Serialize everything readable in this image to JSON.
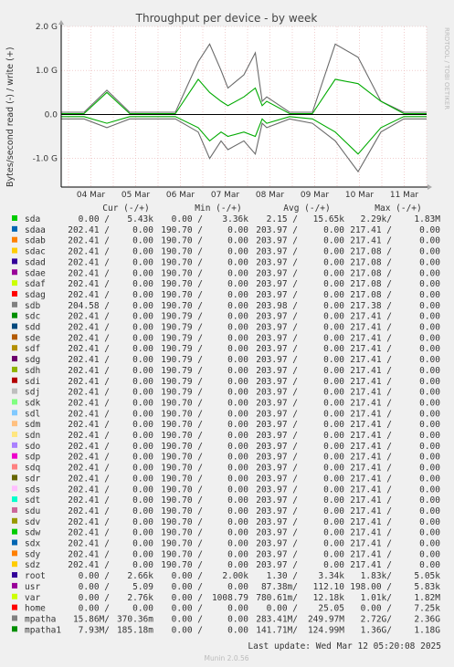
{
  "chart_data": {
    "type": "line",
    "title": "Throughput per device - by week",
    "ylabel": "Bytes/second read (-) / write (+)",
    "side_label": "RRDTOOL / TOBI OETIKER",
    "ylim": [
      -1.65,
      2.0
    ],
    "y_ticks": [
      {
        "value": 2.0,
        "label": "2.0 G"
      },
      {
        "value": 1.0,
        "label": "1.0 G"
      },
      {
        "value": 0.0,
        "label": "0.0"
      },
      {
        "value": -1.0,
        "label": "-1.0 G"
      }
    ],
    "x_ticks": [
      "04 Mar",
      "05 Mar",
      "06 Mar",
      "07 Mar",
      "08 Mar",
      "09 Mar",
      "10 Mar",
      "11 Mar"
    ],
    "columns": [
      "Cur (-/+)",
      "Min (-/+)",
      "Avg (-/+)",
      "Max (-/+)"
    ],
    "series": [
      {
        "name": "mpatha",
        "color": "#6a6a6a",
        "write": [
          [
            0,
            0.05
          ],
          [
            1,
            0.05
          ],
          [
            2,
            0.55
          ],
          [
            3,
            0.05
          ],
          [
            4,
            0.05
          ],
          [
            5,
            0.05
          ],
          [
            6,
            1.2
          ],
          [
            6.5,
            1.6
          ],
          [
            7,
            1.0
          ],
          [
            7.3,
            0.6
          ],
          [
            8,
            0.9
          ],
          [
            8.5,
            1.4
          ],
          [
            8.8,
            0.3
          ],
          [
            9,
            0.4
          ],
          [
            10,
            0.05
          ],
          [
            11,
            0.05
          ],
          [
            12,
            1.6
          ],
          [
            13,
            1.3
          ],
          [
            14,
            0.3
          ],
          [
            15,
            0.05
          ],
          [
            16,
            0.05
          ]
        ],
        "read": [
          [
            0,
            -0.1
          ],
          [
            1,
            -0.1
          ],
          [
            2,
            -0.3
          ],
          [
            3,
            -0.1
          ],
          [
            4,
            -0.1
          ],
          [
            5,
            -0.1
          ],
          [
            6,
            -0.4
          ],
          [
            6.5,
            -1.0
          ],
          [
            7,
            -0.6
          ],
          [
            7.3,
            -0.8
          ],
          [
            8,
            -0.6
          ],
          [
            8.5,
            -0.9
          ],
          [
            8.8,
            -0.2
          ],
          [
            9,
            -0.3
          ],
          [
            10,
            -0.1
          ],
          [
            11,
            -0.2
          ],
          [
            12,
            -0.6
          ],
          [
            13,
            -1.3
          ],
          [
            14,
            -0.4
          ],
          [
            15,
            -0.1
          ],
          [
            16,
            -0.1
          ]
        ]
      },
      {
        "name": "mpatha1",
        "color": "#00aa00",
        "write": [
          [
            0,
            0.02
          ],
          [
            1,
            0.02
          ],
          [
            2,
            0.5
          ],
          [
            3,
            0.02
          ],
          [
            4,
            0.02
          ],
          [
            5,
            0.02
          ],
          [
            6,
            0.8
          ],
          [
            6.5,
            0.5
          ],
          [
            7,
            0.3
          ],
          [
            7.3,
            0.2
          ],
          [
            8,
            0.4
          ],
          [
            8.5,
            0.6
          ],
          [
            8.8,
            0.2
          ],
          [
            9,
            0.3
          ],
          [
            10,
            0.02
          ],
          [
            11,
            0.02
          ],
          [
            12,
            0.8
          ],
          [
            13,
            0.7
          ],
          [
            14,
            0.3
          ],
          [
            15,
            0.02
          ],
          [
            16,
            0.02
          ]
        ],
        "read": [
          [
            0,
            -0.05
          ],
          [
            1,
            -0.05
          ],
          [
            2,
            -0.2
          ],
          [
            3,
            -0.05
          ],
          [
            4,
            -0.05
          ],
          [
            5,
            -0.05
          ],
          [
            6,
            -0.3
          ],
          [
            6.5,
            -0.6
          ],
          [
            7,
            -0.4
          ],
          [
            7.3,
            -0.5
          ],
          [
            8,
            -0.4
          ],
          [
            8.5,
            -0.5
          ],
          [
            8.8,
            -0.1
          ],
          [
            9,
            -0.2
          ],
          [
            10,
            -0.05
          ],
          [
            11,
            -0.1
          ],
          [
            12,
            -0.4
          ],
          [
            13,
            -0.9
          ],
          [
            14,
            -0.3
          ],
          [
            15,
            -0.05
          ],
          [
            16,
            -0.05
          ]
        ]
      }
    ],
    "legend_rows": [
      [
        "sda",
        "#00cc00",
        "0.00 /",
        "5.43k",
        "0.00 /",
        "3.36k",
        "2.15 /",
        "15.65k",
        "2.29k/",
        "1.83M"
      ],
      [
        "sdaa",
        "#0066b3",
        "202.41 /",
        "0.00",
        "190.70 /",
        "0.00",
        "203.97 /",
        "0.00",
        "217.41 /",
        "0.00"
      ],
      [
        "sdab",
        "#ff8000",
        "202.41 /",
        "0.00",
        "190.70 /",
        "0.00",
        "203.97 /",
        "0.00",
        "217.41 /",
        "0.00"
      ],
      [
        "sdac",
        "#ffcc00",
        "202.41 /",
        "0.00",
        "190.70 /",
        "0.00",
        "203.97 /",
        "0.00",
        "217.08 /",
        "0.00"
      ],
      [
        "sdad",
        "#330099",
        "202.41 /",
        "0.00",
        "190.70 /",
        "0.00",
        "203.97 /",
        "0.00",
        "217.08 /",
        "0.00"
      ],
      [
        "sdae",
        "#990099",
        "202.41 /",
        "0.00",
        "190.70 /",
        "0.00",
        "203.97 /",
        "0.00",
        "217.08 /",
        "0.00"
      ],
      [
        "sdaf",
        "#ccff00",
        "202.41 /",
        "0.00",
        "190.70 /",
        "0.00",
        "203.97 /",
        "0.00",
        "217.08 /",
        "0.00"
      ],
      [
        "sdag",
        "#ff0000",
        "202.41 /",
        "0.00",
        "190.70 /",
        "0.00",
        "203.97 /",
        "0.00",
        "217.08 /",
        "0.00"
      ],
      [
        "sdb",
        "#808080",
        "204.58 /",
        "0.00",
        "190.70 /",
        "0.00",
        "203.98 /",
        "0.00",
        "217.38 /",
        "0.00"
      ],
      [
        "sdc",
        "#008f00",
        "202.41 /",
        "0.00",
        "190.79 /",
        "0.00",
        "203.97 /",
        "0.00",
        "217.41 /",
        "0.00"
      ],
      [
        "sdd",
        "#00487d",
        "202.41 /",
        "0.00",
        "190.79 /",
        "0.00",
        "203.97 /",
        "0.00",
        "217.41 /",
        "0.00"
      ],
      [
        "sde",
        "#b35a00",
        "202.41 /",
        "0.00",
        "190.79 /",
        "0.00",
        "203.97 /",
        "0.00",
        "217.41 /",
        "0.00"
      ],
      [
        "sdf",
        "#b38f00",
        "202.41 /",
        "0.00",
        "190.79 /",
        "0.00",
        "203.97 /",
        "0.00",
        "217.41 /",
        "0.00"
      ],
      [
        "sdg",
        "#6b006b",
        "202.41 /",
        "0.00",
        "190.79 /",
        "0.00",
        "203.97 /",
        "0.00",
        "217.41 /",
        "0.00"
      ],
      [
        "sdh",
        "#8fb300",
        "202.41 /",
        "0.00",
        "190.79 /",
        "0.00",
        "203.97 /",
        "0.00",
        "217.41 /",
        "0.00"
      ],
      [
        "sdi",
        "#b30000",
        "202.41 /",
        "0.00",
        "190.79 /",
        "0.00",
        "203.97 /",
        "0.00",
        "217.41 /",
        "0.00"
      ],
      [
        "sdj",
        "#bebebe",
        "202.41 /",
        "0.00",
        "190.79 /",
        "0.00",
        "203.97 /",
        "0.00",
        "217.41 /",
        "0.00"
      ],
      [
        "sdk",
        "#80ff80",
        "202.41 /",
        "0.00",
        "190.70 /",
        "0.00",
        "203.97 /",
        "0.00",
        "217.41 /",
        "0.00"
      ],
      [
        "sdl",
        "#80c9ff",
        "202.41 /",
        "0.00",
        "190.70 /",
        "0.00",
        "203.97 /",
        "0.00",
        "217.41 /",
        "0.00"
      ],
      [
        "sdm",
        "#ffc080",
        "202.41 /",
        "0.00",
        "190.70 /",
        "0.00",
        "203.97 /",
        "0.00",
        "217.41 /",
        "0.00"
      ],
      [
        "sdn",
        "#ffe680",
        "202.41 /",
        "0.00",
        "190.70 /",
        "0.00",
        "203.97 /",
        "0.00",
        "217.41 /",
        "0.00"
      ],
      [
        "sdo",
        "#aa80ff",
        "202.41 /",
        "0.00",
        "190.70 /",
        "0.00",
        "203.97 /",
        "0.00",
        "217.41 /",
        "0.00"
      ],
      [
        "sdp",
        "#ee00cc",
        "202.41 /",
        "0.00",
        "190.70 /",
        "0.00",
        "203.97 /",
        "0.00",
        "217.41 /",
        "0.00"
      ],
      [
        "sdq",
        "#ff8080",
        "202.41 /",
        "0.00",
        "190.70 /",
        "0.00",
        "203.97 /",
        "0.00",
        "217.41 /",
        "0.00"
      ],
      [
        "sdr",
        "#666600",
        "202.41 /",
        "0.00",
        "190.70 /",
        "0.00",
        "203.97 /",
        "0.00",
        "217.41 /",
        "0.00"
      ],
      [
        "sds",
        "#ffbfff",
        "202.41 /",
        "0.00",
        "190.70 /",
        "0.00",
        "203.97 /",
        "0.00",
        "217.41 /",
        "0.00"
      ],
      [
        "sdt",
        "#00ffcc",
        "202.41 /",
        "0.00",
        "190.70 /",
        "0.00",
        "203.97 /",
        "0.00",
        "217.41 /",
        "0.00"
      ],
      [
        "sdu",
        "#cc6699",
        "202.41 /",
        "0.00",
        "190.70 /",
        "0.00",
        "203.97 /",
        "0.00",
        "217.41 /",
        "0.00"
      ],
      [
        "sdv",
        "#999900",
        "202.41 /",
        "0.00",
        "190.70 /",
        "0.00",
        "203.97 /",
        "0.00",
        "217.41 /",
        "0.00"
      ],
      [
        "sdw",
        "#00cc00",
        "202.41 /",
        "0.00",
        "190.70 /",
        "0.00",
        "203.97 /",
        "0.00",
        "217.41 /",
        "0.00"
      ],
      [
        "sdx",
        "#0066b3",
        "202.41 /",
        "0.00",
        "190.70 /",
        "0.00",
        "203.97 /",
        "0.00",
        "217.41 /",
        "0.00"
      ],
      [
        "sdy",
        "#ff8000",
        "202.41 /",
        "0.00",
        "190.70 /",
        "0.00",
        "203.97 /",
        "0.00",
        "217.41 /",
        "0.00"
      ],
      [
        "sdz",
        "#ffcc00",
        "202.41 /",
        "0.00",
        "190.70 /",
        "0.00",
        "203.97 /",
        "0.00",
        "217.41 /",
        "0.00"
      ],
      [
        "root",
        "#330099",
        "0.00 /",
        "2.66k",
        "0.00 /",
        "2.00k",
        "1.30 /",
        "3.34k",
        "1.83k/",
        "5.05k"
      ],
      [
        "usr",
        "#990099",
        "0.00 /",
        "5.09",
        "0.00 /",
        "0.00",
        "87.38m/",
        "112.10",
        "198.00 /",
        "5.83k"
      ],
      [
        "var",
        "#ccff00",
        "0.00 /",
        "2.76k",
        "0.00 /",
        "1008.79",
        "780.61m/",
        "12.18k",
        "1.01k/",
        "1.82M"
      ],
      [
        "home",
        "#ff0000",
        "0.00 /",
        "0.00",
        "0.00 /",
        "0.00",
        "0.00 /",
        "25.05",
        "0.00 /",
        "7.25k"
      ],
      [
        "mpatha",
        "#808080",
        "15.86M/",
        "370.36m",
        "0.00 /",
        "0.00",
        "283.41M/",
        "249.97M",
        "2.72G/",
        "2.36G"
      ],
      [
        "mpatha1",
        "#008f00",
        "7.93M/",
        "185.18m",
        "0.00 /",
        "0.00",
        "141.71M/",
        "124.99M",
        "1.36G/",
        "1.18G"
      ]
    ],
    "last_update": "Last update: Wed Mar 12 05:20:08 2025",
    "footer": "Munin 2.0.56"
  }
}
